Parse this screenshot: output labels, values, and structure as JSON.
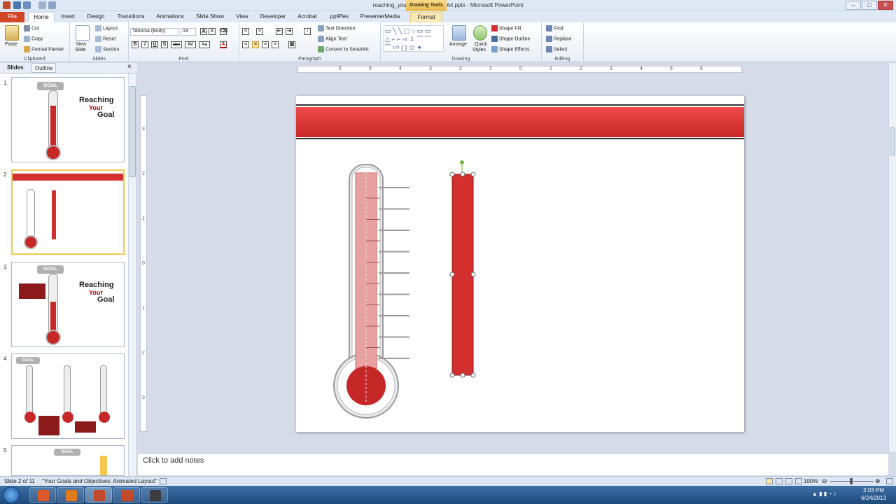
{
  "window": {
    "title": "reaching_your_goal_2010_6664.pptx - Microsoft PowerPoint",
    "contextual_tab": "Drawing Tools"
  },
  "tabs": [
    "File",
    "Home",
    "Insert",
    "Design",
    "Transitions",
    "Animations",
    "Slide Show",
    "View",
    "Developer",
    "Acrobat",
    "pptPlex",
    "PresenterMedia",
    "Format"
  ],
  "ribbon": {
    "clipboard": {
      "paste": "Paste",
      "cut": "Cut",
      "copy": "Copy",
      "format_painter": "Format Painter",
      "label": "Clipboard"
    },
    "slides": {
      "new_slide_1": "New",
      "new_slide_2": "Slide",
      "layout": "Layout",
      "reset": "Reset",
      "section": "Section",
      "label": "Slides"
    },
    "font": {
      "name": "Tahoma (Body)",
      "size": "18",
      "bold": "B",
      "italic": "I",
      "underline": "U",
      "shadow": "S",
      "strike": "abc",
      "spacing": "AV",
      "case": "Aa",
      "color": "A",
      "label": "Font"
    },
    "paragraph": {
      "text_direction": "Text Direction",
      "align_text": "Align Text",
      "smartart": "Convert to SmartArt",
      "label": "Paragraph"
    },
    "drawing": {
      "arrange": "Arrange",
      "quick_styles_1": "Quick",
      "quick_styles_2": "Styles",
      "shape_fill": "Shape Fill",
      "shape_outline": "Shape Outline",
      "shape_effects": "Shape Effects",
      "label": "Drawing"
    },
    "editing": {
      "find": "Find",
      "replace": "Replace",
      "select": "Select",
      "label": "Editing"
    }
  },
  "left_pane": {
    "tabs": [
      "Slides",
      "Outline"
    ],
    "close": "×",
    "slides": [
      {
        "num": "1",
        "title1": "Reaching",
        "title2": "Your",
        "title3": "Goal",
        "goal": "GOAL"
      },
      {
        "num": "2"
      },
      {
        "num": "3",
        "title1": "Reaching",
        "title2": "Your",
        "title3": "Goal",
        "goal": "GOAL"
      },
      {
        "num": "4",
        "goal": "GOAL"
      },
      {
        "num": "5",
        "goal": "GOAL"
      }
    ]
  },
  "notes": {
    "placeholder": "Click to add notes"
  },
  "status": {
    "slide": "Slide 2 of 11",
    "theme": "\"Your Goals and Objectives: Animated Layout\"",
    "zoom": "100%"
  },
  "taskbar": {
    "time": "2:03 PM",
    "date": "6/24/2013"
  },
  "ruler": {
    "h_labels": [
      "6",
      "5",
      "4",
      "3",
      "2",
      "1",
      "0",
      "1",
      "2",
      "3",
      "4",
      "5",
      "6"
    ],
    "v_labels": [
      "3",
      "2",
      "1",
      "0",
      "1",
      "2",
      "3"
    ]
  },
  "colors": {
    "accent_red": "#d32f2f",
    "file_tab": "#d24726",
    "ribbon_bg": "#e9eef6",
    "selection": "#f2c84f"
  }
}
